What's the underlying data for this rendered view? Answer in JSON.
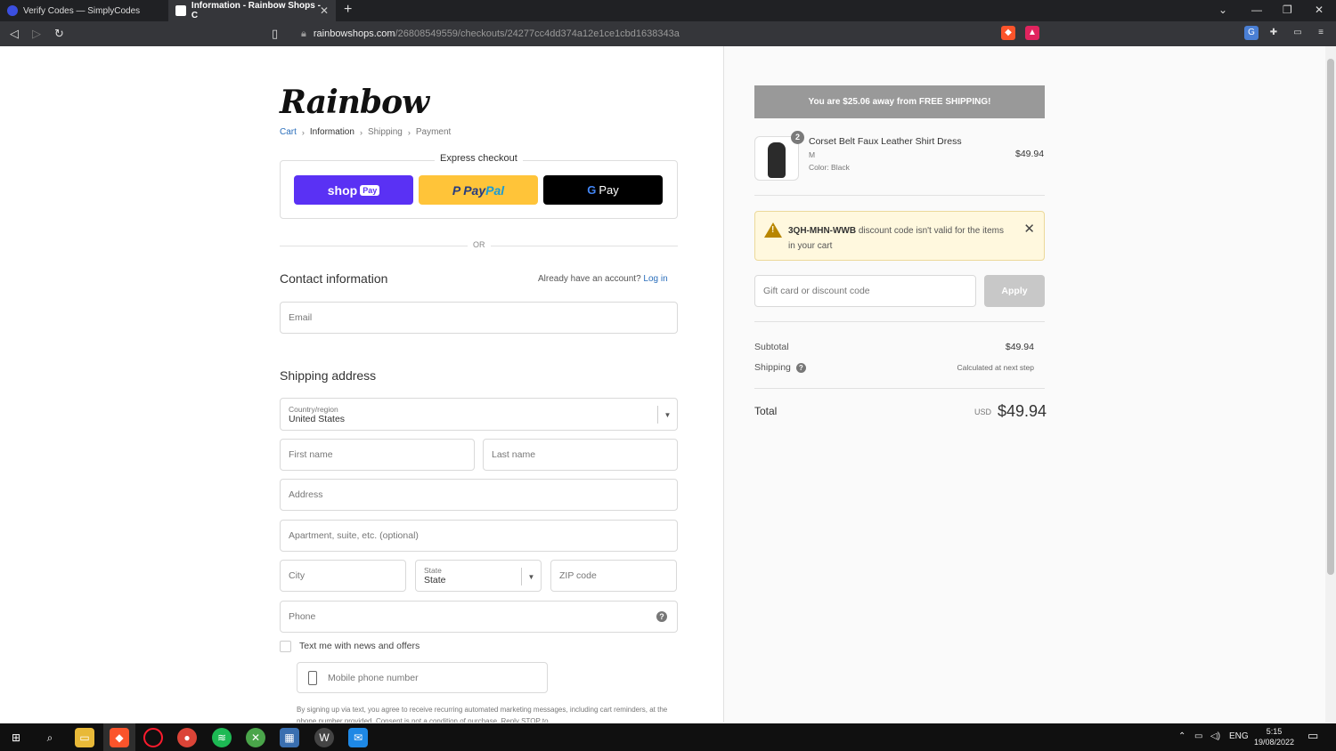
{
  "browser": {
    "tabs": [
      {
        "label": "Verify Codes — SimplyCodes"
      },
      {
        "label": "Information - Rainbow Shops - C"
      }
    ],
    "new_tab": "+",
    "url_host": "rainbowshops.com",
    "url_path": "/26808549559/checkouts/24277cc4dd374a12e1ce1cbd1638343a"
  },
  "checkout": {
    "logo": "Rainbow",
    "breadcrumb": [
      "Cart",
      "Information",
      "Shipping",
      "Payment"
    ],
    "express_title": "Express checkout",
    "shop_pay": {
      "shop": "shop",
      "pay": "Pay"
    },
    "paypal": {
      "pay": "Pay",
      "pal": "Pal"
    },
    "gpay": {
      "g": "G",
      "pay": "Pay"
    },
    "or": "OR",
    "contact_title": "Contact information",
    "account_prompt": "Already have an account?",
    "login": "Log in",
    "email_placeholder": "Email",
    "shipping_title": "Shipping address",
    "country_label": "Country/region",
    "country_value": "United States",
    "first_name": "First name",
    "last_name": "Last name",
    "address": "Address",
    "apartment": "Apartment, suite, etc. (optional)",
    "city": "City",
    "state_label": "State",
    "state_value": "State",
    "zip": "ZIP code",
    "phone": "Phone",
    "text_me": "Text me with news and offers",
    "mobile_placeholder": "Mobile phone number",
    "disclaimer": "By signing up via text, you agree to receive recurring automated marketing messages, including cart reminders, at the phone number provided. Consent is not a condition of purchase. Reply STOP to"
  },
  "summary": {
    "shipping_banner": "You are $25.06 away from FREE SHIPPING!",
    "product": {
      "qty": "2",
      "name": "Corset Belt Faux Leather Shirt Dress",
      "size": "M",
      "color": "Color: Black",
      "price": "$49.94"
    },
    "warning": {
      "code": "3QH-MHN-WWB",
      "text": "discount code isn't valid for the items in your cart"
    },
    "gift_placeholder": "Gift card or discount code",
    "apply": "Apply",
    "subtotal_label": "Subtotal",
    "subtotal_value": "$49.94",
    "shipping_label": "Shipping",
    "shipping_value": "Calculated at next step",
    "total_label": "Total",
    "currency": "USD",
    "total_value": "$49.94"
  },
  "taskbar": {
    "lang": "ENG",
    "time": "5:15",
    "date": "19/08/2022"
  }
}
